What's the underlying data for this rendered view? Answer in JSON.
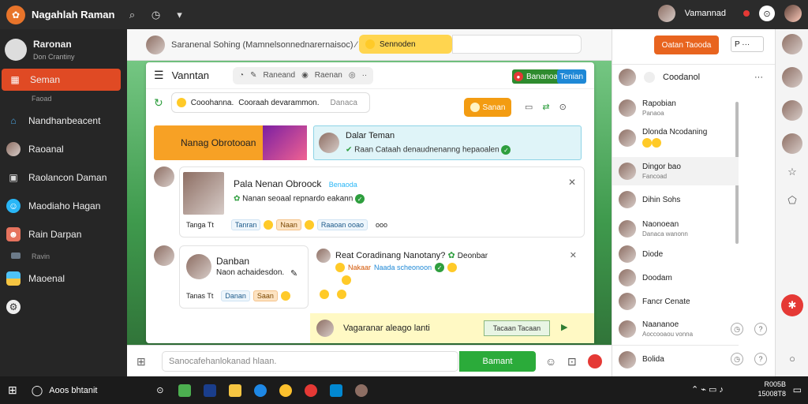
{
  "topbar": {
    "app_title": "Nagahlah Raman",
    "user_name": "Vamannad",
    "circle_btn": "⊙"
  },
  "sidebar": {
    "profile_name": "Raronan",
    "profile_sub": "Don Crantiny",
    "items": [
      {
        "label": "Seman",
        "icon": "calendar-icon",
        "color": "#e04a24"
      },
      {
        "label": "Nandhanbeacent",
        "icon": "home-icon",
        "color": "#4aa3df"
      },
      {
        "label": "Raoanal",
        "icon": "user-icon",
        "color": "#8d6e63"
      },
      {
        "label": "Raolancon Daman",
        "icon": "briefcase-icon",
        "color": "#9e9e9e"
      },
      {
        "label": "Maodiaho Hagan",
        "icon": "chat-icon",
        "color": "#29b6f6"
      },
      {
        "label": "Rain Darpan",
        "icon": "people-icon",
        "color": "#e6735e"
      },
      {
        "label": "Maoenal",
        "icon": "image-icon",
        "color": "#f5c542"
      }
    ],
    "sub_labels": [
      "Faoad",
      "Ravin"
    ]
  },
  "main": {
    "header_crumb": "Saranenal Sohing (Mamnelsonnednarernaisoc) ⁄",
    "yellow_pill": "Sennoden",
    "channel": "Vanntan",
    "seg_items": [
      "Raneand",
      "Raenan"
    ],
    "green_chip": "Bananoa",
    "blue_chip": "Tenian",
    "topic_text": "Cooohanna.",
    "topic_sub": "Cooraah devarammon.",
    "topic_hint": "Danaca",
    "orange_btn": "Sanan",
    "banner_orange": "Nanag Obrotooan",
    "banner_blue_title": "Dalar Teman",
    "banner_blue_sub": "Raan Cataah denaudnenanng hepaoalen",
    "post1": {
      "title": "Pala Nenan Obroock",
      "title_tag": "Benaoda",
      "line": "Nanan seoaal repnardo eakann",
      "chips": [
        "Tanran",
        "Naan",
        "Raaoan ooao"
      ],
      "meta": "Tanga  Tt",
      "extra": "ooo"
    },
    "post2": {
      "name": "Danban",
      "line": "Naon achaidesdon.",
      "chips": [
        "Danan",
        "Saan"
      ],
      "meta": "Tanas  Tt"
    },
    "post3": {
      "title": "Reat Coradinang Nanotany?",
      "tag": "Deonbar",
      "chips": [
        "Nakaar",
        "Naada scheonoon"
      ]
    },
    "yellow_bar": {
      "text": "Vagaranar aleago lanti",
      "btn": "Tacaan Tacaan"
    }
  },
  "compose": {
    "placeholder": "Sanocafehanlokanad hlaan.",
    "send": "Bamant"
  },
  "rightpanel": {
    "orange_btn": "Oatan Taooda",
    "box_text": "P   ···",
    "header": "Coodanol",
    "contacts": [
      {
        "name": "Rapobian",
        "sub": "Panaoa"
      },
      {
        "name": "Dlonda Ncodaning",
        "sub": ""
      },
      {
        "name": "Dingor bao",
        "sub": "Fancoad"
      },
      {
        "name": "Dihin Sohs",
        "sub": ""
      },
      {
        "name": "Naonoean",
        "sub": "Danaca wanonn"
      },
      {
        "name": "Diode",
        "sub": ""
      },
      {
        "name": "Doodam",
        "sub": ""
      },
      {
        "name": "Fancr Cenate",
        "sub": ""
      },
      {
        "name": "Naananoe",
        "sub": "Aoccooaou vonna"
      },
      {
        "name": "Bolida",
        "sub": ""
      }
    ]
  },
  "taskbar": {
    "search": "Aoos bhtanit",
    "time": "R005B",
    "date": "15008T8"
  }
}
